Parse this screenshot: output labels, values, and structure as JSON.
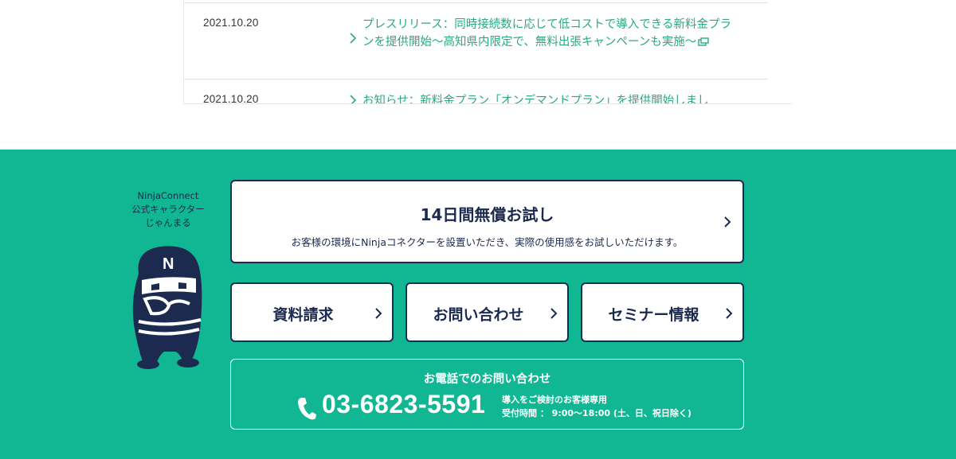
{
  "news": {
    "items": [
      {
        "date": "2021.10.20",
        "title": "プレスリリース：同時接続数に応じて低コストで導入できる新料金プランを提供開始〜高知県内限定で、無料出張キャンペーンも実施〜"
      },
      {
        "date": "2021.10.20",
        "title": "お知らせ：新料金プラン「オンデマンドプラン」を提供開始しまし"
      }
    ]
  },
  "mascot": {
    "line1": "NinjaConnect",
    "line2": "公式キャラクター",
    "line3": "じゃんまる",
    "badge_letter": "N"
  },
  "trial": {
    "title": "14日間無償お試し",
    "subtitle": "お客様の環境にNinjaコネクターを設置いただき、実際の使用感をお試しいただけます。"
  },
  "buttons": {
    "documents": "資料請求",
    "contact": "お問い合わせ",
    "seminar": "セミナー情報"
  },
  "phone": {
    "title": "お電話でのお問い合わせ",
    "number": "03-6823-5591",
    "note1": "導入をご検討のお客様専用",
    "note2": "受付時間 ： 9:00〜18:00 (土、日、祝日除く)"
  },
  "colors": {
    "accent_green": "#11b693",
    "link_green": "#2aa882",
    "navy": "#1b2a4e"
  }
}
